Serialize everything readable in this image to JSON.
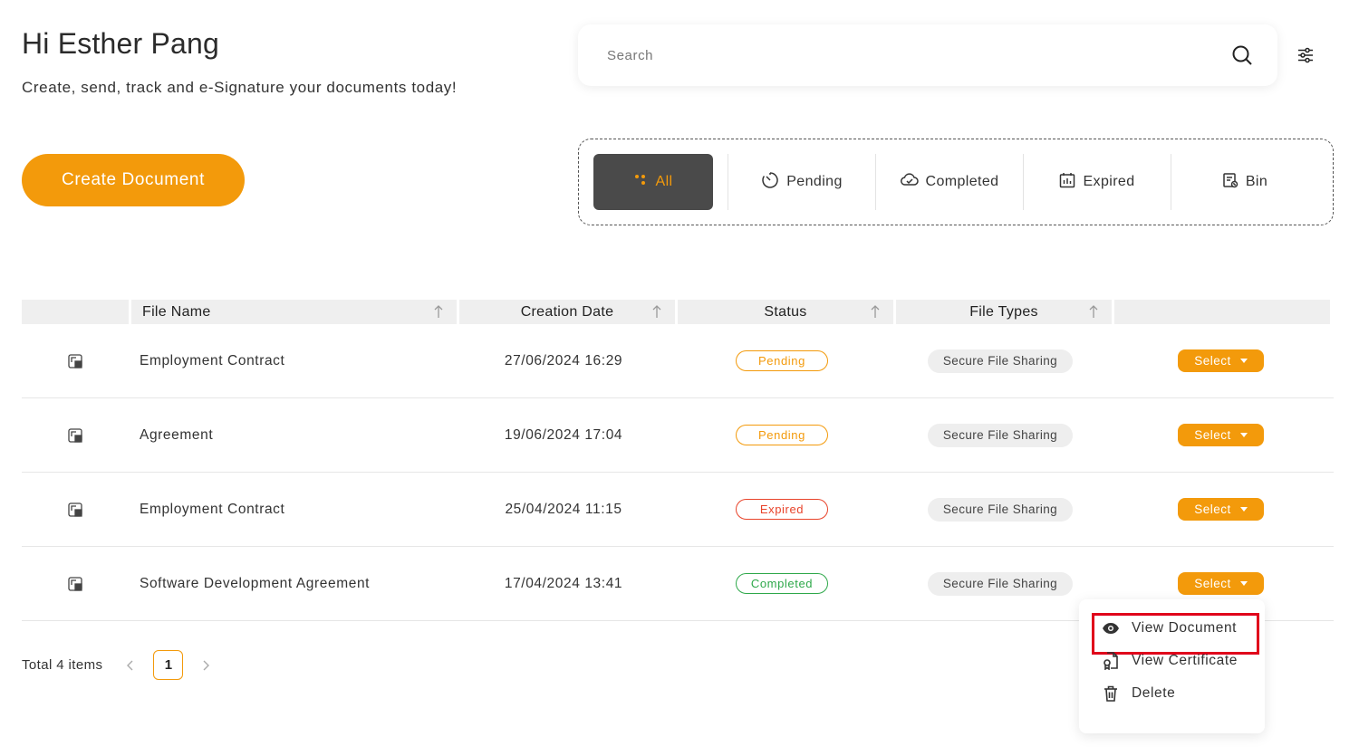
{
  "header": {
    "greeting": "Hi Esther Pang",
    "subtitle": "Create, send, track and e-Signature your documents today!"
  },
  "search": {
    "placeholder": "Search",
    "value": ""
  },
  "create_button": "Create Document",
  "tabs": [
    {
      "label": "All",
      "icon": "dots-grid-icon",
      "active": true
    },
    {
      "label": "Pending",
      "icon": "timer-icon",
      "active": false
    },
    {
      "label": "Completed",
      "icon": "cloud-check-icon",
      "active": false
    },
    {
      "label": "Expired",
      "icon": "calendar-chart-icon",
      "active": false
    },
    {
      "label": "Bin",
      "icon": "bin-icon",
      "active": false
    }
  ],
  "table": {
    "columns": [
      "",
      "File Name",
      "Creation Date",
      "Status",
      "File Types",
      ""
    ],
    "rows": [
      {
        "file_name": "Employment Contract",
        "date": "27/06/2024 16:29",
        "status": "Pending",
        "file_type": "Secure File Sharing",
        "action": "Select"
      },
      {
        "file_name": "Agreement",
        "date": "19/06/2024 17:04",
        "status": "Pending",
        "file_type": "Secure File Sharing",
        "action": "Select"
      },
      {
        "file_name": "Employment Contract",
        "date": "25/04/2024 11:15",
        "status": "Expired",
        "file_type": "Secure File Sharing",
        "action": "Select"
      },
      {
        "file_name": "Software Development Agreement",
        "date": "17/04/2024 13:41",
        "status": "Completed",
        "file_type": "Secure File Sharing",
        "action": "Select"
      }
    ]
  },
  "pagination": {
    "total": "Total 4 items",
    "current_page": "1",
    "prev": "<",
    "next": ">"
  },
  "dropdown_menu": [
    {
      "label": "View Document",
      "icon": "eye-icon",
      "highlighted": true
    },
    {
      "label": "View Certificate",
      "icon": "certificate-icon",
      "highlighted": false
    },
    {
      "label": "Delete",
      "icon": "trash-icon",
      "highlighted": false
    }
  ],
  "colors": {
    "accent": "#f39a0b",
    "pending": "#f39a0b",
    "expired": "#e8432a",
    "completed": "#2ea84a",
    "highlight_box": "#e0001b",
    "active_tab_bg": "#4a4a4a"
  }
}
